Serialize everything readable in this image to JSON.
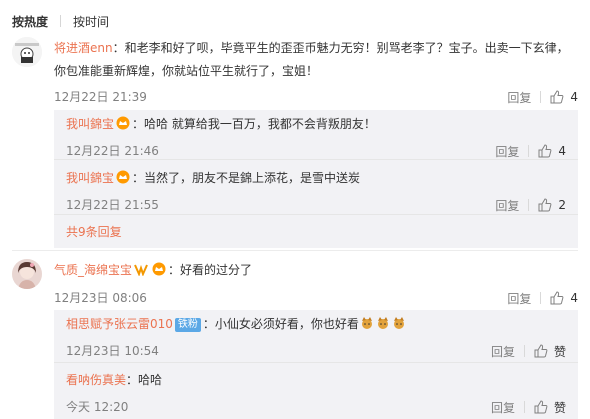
{
  "sort": {
    "hot_label": "按热度",
    "time_label": "按时间"
  },
  "comments": [
    {
      "user": "将进酒enn",
      "text": "：和老李和好了呗，毕竟平生的歪歪币魅力无穷！别骂老李了？宝子。出卖一下玄律，你包准能重新辉煌，你就站位平生就行了，宝姐！",
      "time": "12月22日 21:39",
      "reply_label": "回复",
      "likes": "4",
      "replies": [
        {
          "user": "我叫錦宝",
          "text": "：哈哈 就算给我一百万，我都不会背叛朋友！",
          "time": "12月22日 21:46",
          "reply_label": "回复",
          "likes": "4"
        },
        {
          "user": "我叫錦宝",
          "text": "：当然了，朋友不是錦上添花，是雪中送炭",
          "time": "12月22日 21:55",
          "reply_label": "回复",
          "likes": "2"
        }
      ],
      "more_replies": "共9条回复"
    },
    {
      "user": "气质_海绵宝宝",
      "text": "：好看的过分了",
      "time": "12月23日 08:06",
      "reply_label": "回复",
      "likes": "4",
      "replies": [
        {
          "user": "相思赋予张云雷010",
          "tag": "铁粉",
          "text": "：小仙女必须好看，你也好看",
          "time": "12月23日 10:54",
          "reply_label": "回复",
          "likes": "赞"
        },
        {
          "user": "看呐伤真美",
          "text": "：哈哈",
          "time": "今天 12:20",
          "reply_label": "回复",
          "likes": "赞"
        }
      ]
    }
  ],
  "colors": {
    "username": "#eb7350",
    "reply_bg": "#f2f2f5",
    "meta": "#808080"
  },
  "icons": {
    "like": "thumb-up-icon",
    "vip": "vip-crown-icon",
    "emoji": "doge-emoji-icon"
  }
}
